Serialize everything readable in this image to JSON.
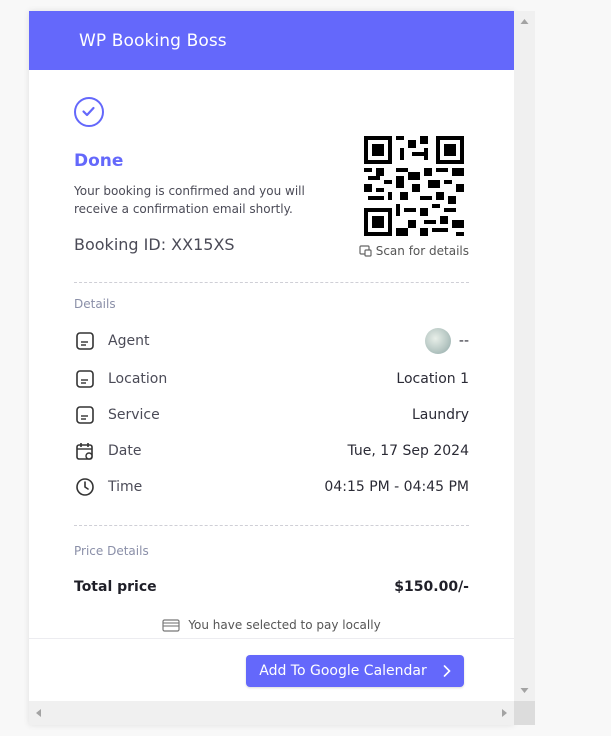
{
  "header": {
    "title": "WP Booking Boss"
  },
  "confirmation": {
    "title": "Done",
    "message": "Your booking is confirmed and you will receive a confirmation email shortly.",
    "booking_id": "Booking ID: XX15XS",
    "scan_label": "Scan for details"
  },
  "details": {
    "label": "Details",
    "rows": [
      {
        "icon": "document-icon",
        "label": "Agent",
        "value": "--"
      },
      {
        "icon": "document-icon",
        "label": "Location",
        "value": "Location 1"
      },
      {
        "icon": "document-icon",
        "label": "Service",
        "value": "Laundry"
      },
      {
        "icon": "calendar-icon",
        "label": "Date",
        "value": "Tue, 17 Sep 2024"
      },
      {
        "icon": "clock-icon",
        "label": "Time",
        "value": "04:15 PM - 04:45 PM"
      }
    ]
  },
  "price": {
    "label": "Price Details",
    "total_label": "Total price",
    "total_value": "$150.00/-",
    "pay_note": "You have selected to pay locally"
  },
  "actions": {
    "calendar_button": "Add To Google Calendar"
  },
  "colors": {
    "accent": "#6468fb",
    "header_text": "#ffffff"
  }
}
